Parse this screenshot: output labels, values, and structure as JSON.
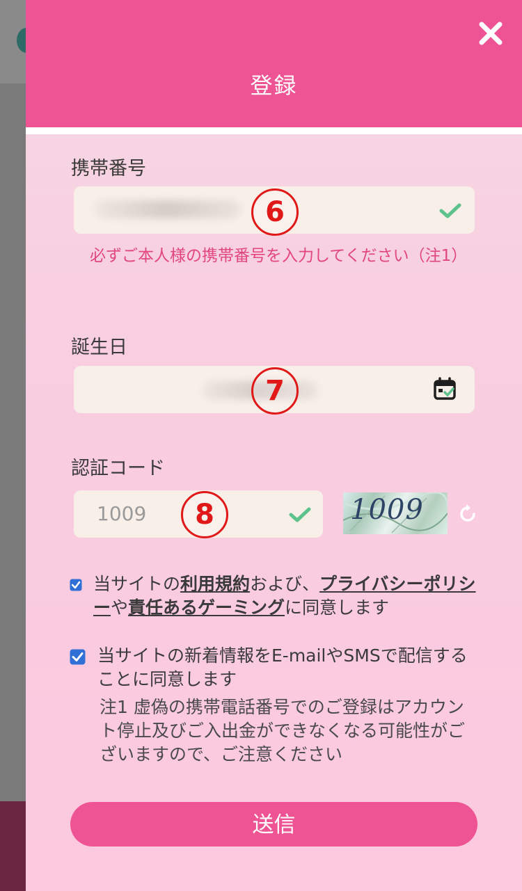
{
  "header": {
    "title": "登録"
  },
  "phone": {
    "label": "携帯番号",
    "marker": "6",
    "note": "必ずご本人様の携帯番号を入力してください（注1）"
  },
  "birthday": {
    "label": "誕生日",
    "marker": "7"
  },
  "captcha": {
    "label": "認証コード",
    "value": "1009",
    "image_text": "1009",
    "marker": "8"
  },
  "agreements": {
    "terms": {
      "checked": true,
      "prefix": "当サイトの",
      "link_terms": "利用規約",
      "mid1": "および、",
      "link_privacy": "プライバシーポリシー",
      "mid2": "や",
      "link_gaming": "責任あるゲーミング",
      "suffix": "に同意します"
    },
    "newsletter": {
      "checked": true,
      "text": "当サイトの新着情報をE-mailやSMSで配信することに同意します"
    },
    "footnote": "注1 虚偽の携帯電話番号でのご登録はアカウント停止及びご入出金ができなくなる可能性がございますので、ご注意ください"
  },
  "submit": {
    "label": "送信"
  },
  "colors": {
    "accent": "#ee5493",
    "note": "#e2467e",
    "check": "#5ec28d",
    "marker": "#e01818"
  },
  "icons": [
    "close-icon",
    "check-icon",
    "calendar-icon",
    "refresh-icon"
  ]
}
